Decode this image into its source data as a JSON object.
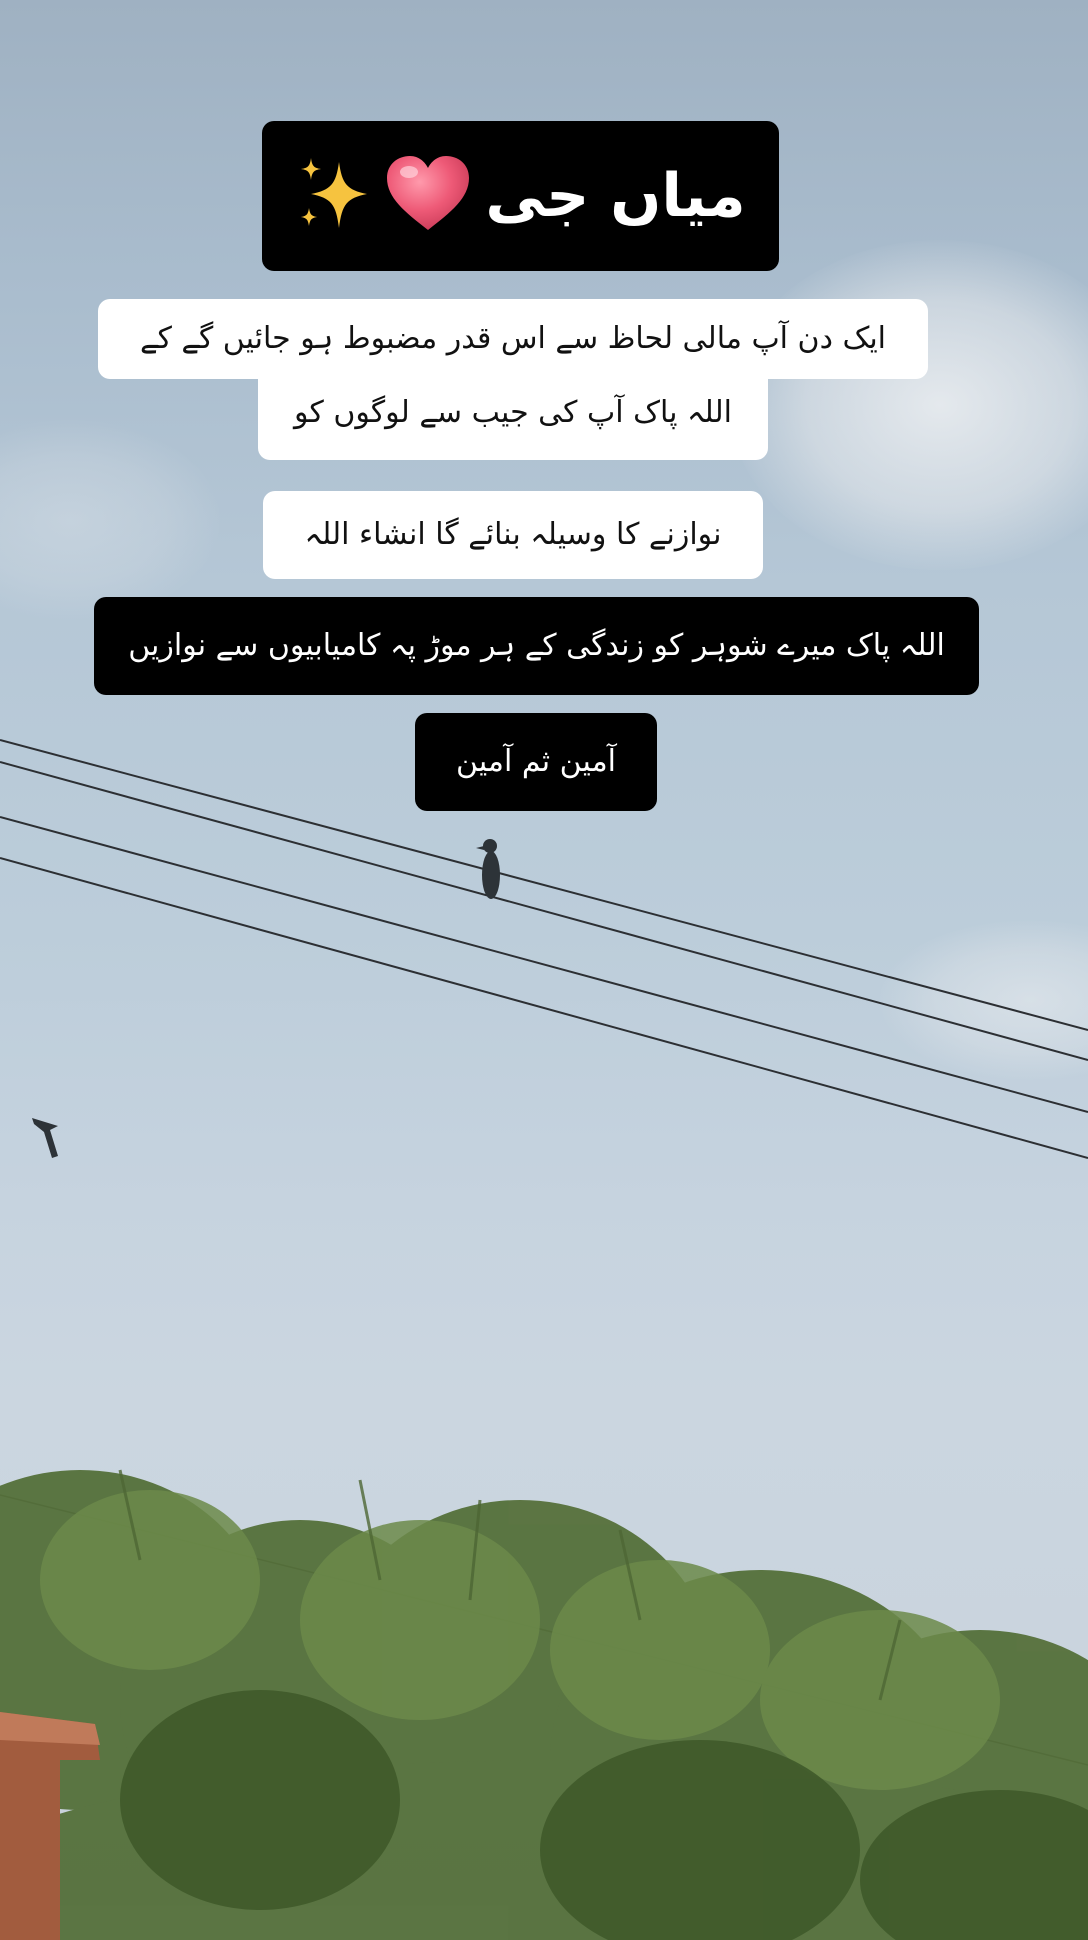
{
  "title": {
    "text": "میاں جی",
    "heart_emoji": "heart-icon",
    "sparkles_emoji": "sparkles-icon"
  },
  "captions": [
    {
      "text": "ایک دن آپ مالی لحاظ سے اس قدر مضبوط ہو جائیں گے کے",
      "style": "light"
    },
    {
      "text": "اللہ پاک آپ کی جیب سے لوگوں کو",
      "style": "light"
    },
    {
      "text": "نوازنے کا وسیلہ بنائے گا انشاء اللہ",
      "style": "light"
    },
    {
      "text": "اللہ پاک میرے شوہر کو زندگی کے ہر موڑ پہ کامیابیوں سے نوازیں",
      "style": "dark"
    },
    {
      "text": "آمین ثم آمین",
      "style": "dark"
    }
  ],
  "colors": {
    "sky": "#b5c7d6",
    "caption_dark_bg": "#000000",
    "caption_light_bg": "#ffffff",
    "foliage": "#4f6a32",
    "heart": "#e8536f",
    "sparkle": "#f5c542"
  }
}
